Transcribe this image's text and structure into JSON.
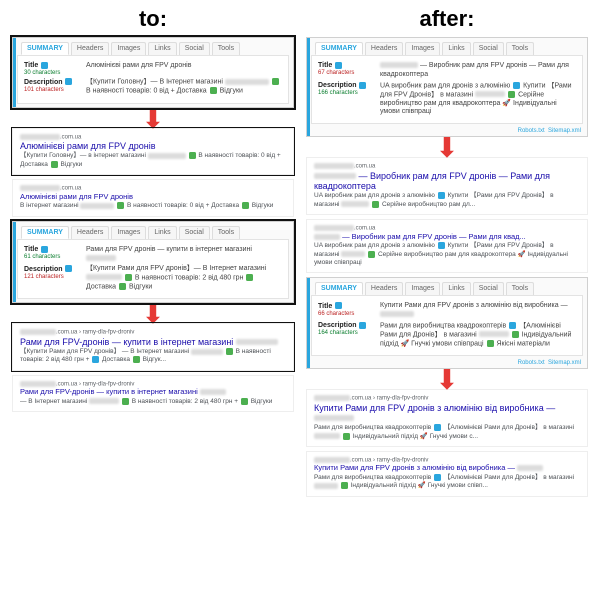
{
  "headings": {
    "left": "to:",
    "right": "after:"
  },
  "tabs": [
    "SUMMARY",
    "Headers",
    "Images",
    "Links",
    "Social",
    "Tools"
  ],
  "labels": {
    "title": "Title",
    "desc": "Description"
  },
  "foot": {
    "robots": "Robots.txt",
    "sitemap": "Sitemap.xml"
  },
  "left": {
    "p1": {
      "titleChars": "30 characters",
      "titleOk": true,
      "titleVal": "Алюмінієві рами для FPV дронів",
      "descChars": "101 characters",
      "descOk": false,
      "descVal": "【Купити Головну】— В Інтернет магазині",
      "descVal2": "В наявності товарів: 0 від + Доставка",
      "descVal3": "Відгуки"
    },
    "serpA": {
      "url": ".com.ua",
      "title": "Алюмінієві рами для FPV дронів",
      "desc1": "【Купити Головну】— в інтернет магазині",
      "desc2": "В наявності товарів: 0 від + Доставка",
      "desc3": "Відгуки"
    },
    "serpB": {
      "url": ".com.ua",
      "title": "Алюмінієві рами для FPV дронів",
      "desc": "В інтернет магазині",
      "desc2": "В наявності товарів: 0 від + Доставка",
      "desc3": "Відгуки"
    },
    "p2": {
      "titleChars": "61 characters",
      "titleOk": true,
      "titleVal": "Рами для FPV дронів — купити в інтернет магазині",
      "descChars": "121 characters",
      "descOk": false,
      "descVal": "【Купити Рами для FPV дронів】— В Інтернет магазині",
      "descVal2": "В наявності товарів: 2 від 480 грн",
      "descVal3": "Доставка",
      "descVal4": "Відгуки"
    },
    "serpC": {
      "url": ".com.ua › ramy-dla-fpv-droniv",
      "title": "Рами для FPV-дронів — купити в інтернет магазині",
      "desc": "— В Інтернет магазині",
      "desc2": "В наявності товарів: 2 від 480 грн +",
      "desc3": "Доставка",
      "desc4": "Відгук..."
    },
    "serpD": {
      "url": ".com.ua › ramy-dla-fpv-droniv",
      "title": "Рами для FPV-дронів — купити в інтернет магазині",
      "desc": "— В Інтернет магазині",
      "desc2": "В наявності товарів: 2 від 480 грн +",
      "desc3": "Відгуки"
    }
  },
  "right": {
    "p1": {
      "titleChars": "67 characters",
      "titleOk": false,
      "titleVal": "— Виробник рам для FPV дронів — Рами для квадрокоптера",
      "descChars": "166 characters",
      "descOk": true,
      "descVal": "UA виробник рам для дронів з алюмінію",
      "descVal2": "Купити 【Рами для FPV Дронів】 в магазині",
      "descVal3": "Серійне виробництво рам для квадрокоптера 🚀 Індивідуальні умови співпраці"
    },
    "serpA": {
      "url": ".com.ua",
      "title": "— Виробник рам для FPV дронів — Рами для квадрокоптера",
      "desc": "UA виробник рам для дронів з алюмінію",
      "desc2": "Купити 【Рами для FPV Дронів】 в магазині",
      "desc3": "Серійне виробництво рам дл..."
    },
    "serpB": {
      "url": ".com.ua",
      "title": "— Виробник рам для FPV дронів — Рами для квад...",
      "desc": "UA виробник рам для дронів з алюмінію",
      "desc2": "Купити 【Рами для FPV Дронів】 в магазині",
      "desc3": "Серійне виробництво рам для квадрокоптера 🚀 Індивідуальні умови співпраці"
    },
    "p2": {
      "titleChars": "66 characters",
      "titleOk": false,
      "titleVal": "Купити Рами для FPV дронів з алюмінію від виробника —",
      "descChars": "164 characters",
      "descOk": true,
      "descVal": "Рами для виробництва квадрокоптерів",
      "descVal2": "【Алюмінієві Рами для Дронів】 в магазині",
      "descVal3": "Індивідуальний підхід 🚀 Гнучкі умови співпраці",
      "descVal4": "Якісні матеріали"
    },
    "serpC": {
      "url": ".com.ua › ramy-dla-fpv-droniv",
      "title": "Купити Рами для FPV дронів з алюмінію від виробника —",
      "desc": "Рами для виробництва квадрокоптерів",
      "desc2": "【Алюмінієві Рами для Дронів】 в магазині",
      "desc3": "Індивідуальний підхід 🚀 Гнучкі умови с..."
    },
    "serpD": {
      "url": ".com.ua › ramy-dla-fpv-droniv",
      "title": "Купити Рами для FPV дронів з алюмінію від виробника —",
      "desc": "Рами для виробництва квадрокоптерів",
      "desc2": "【Алюмінієві Рами для Дронів】 в магазині",
      "desc3": "Індивідуальний підхід 🚀 Гнучкі умови співп..."
    }
  }
}
